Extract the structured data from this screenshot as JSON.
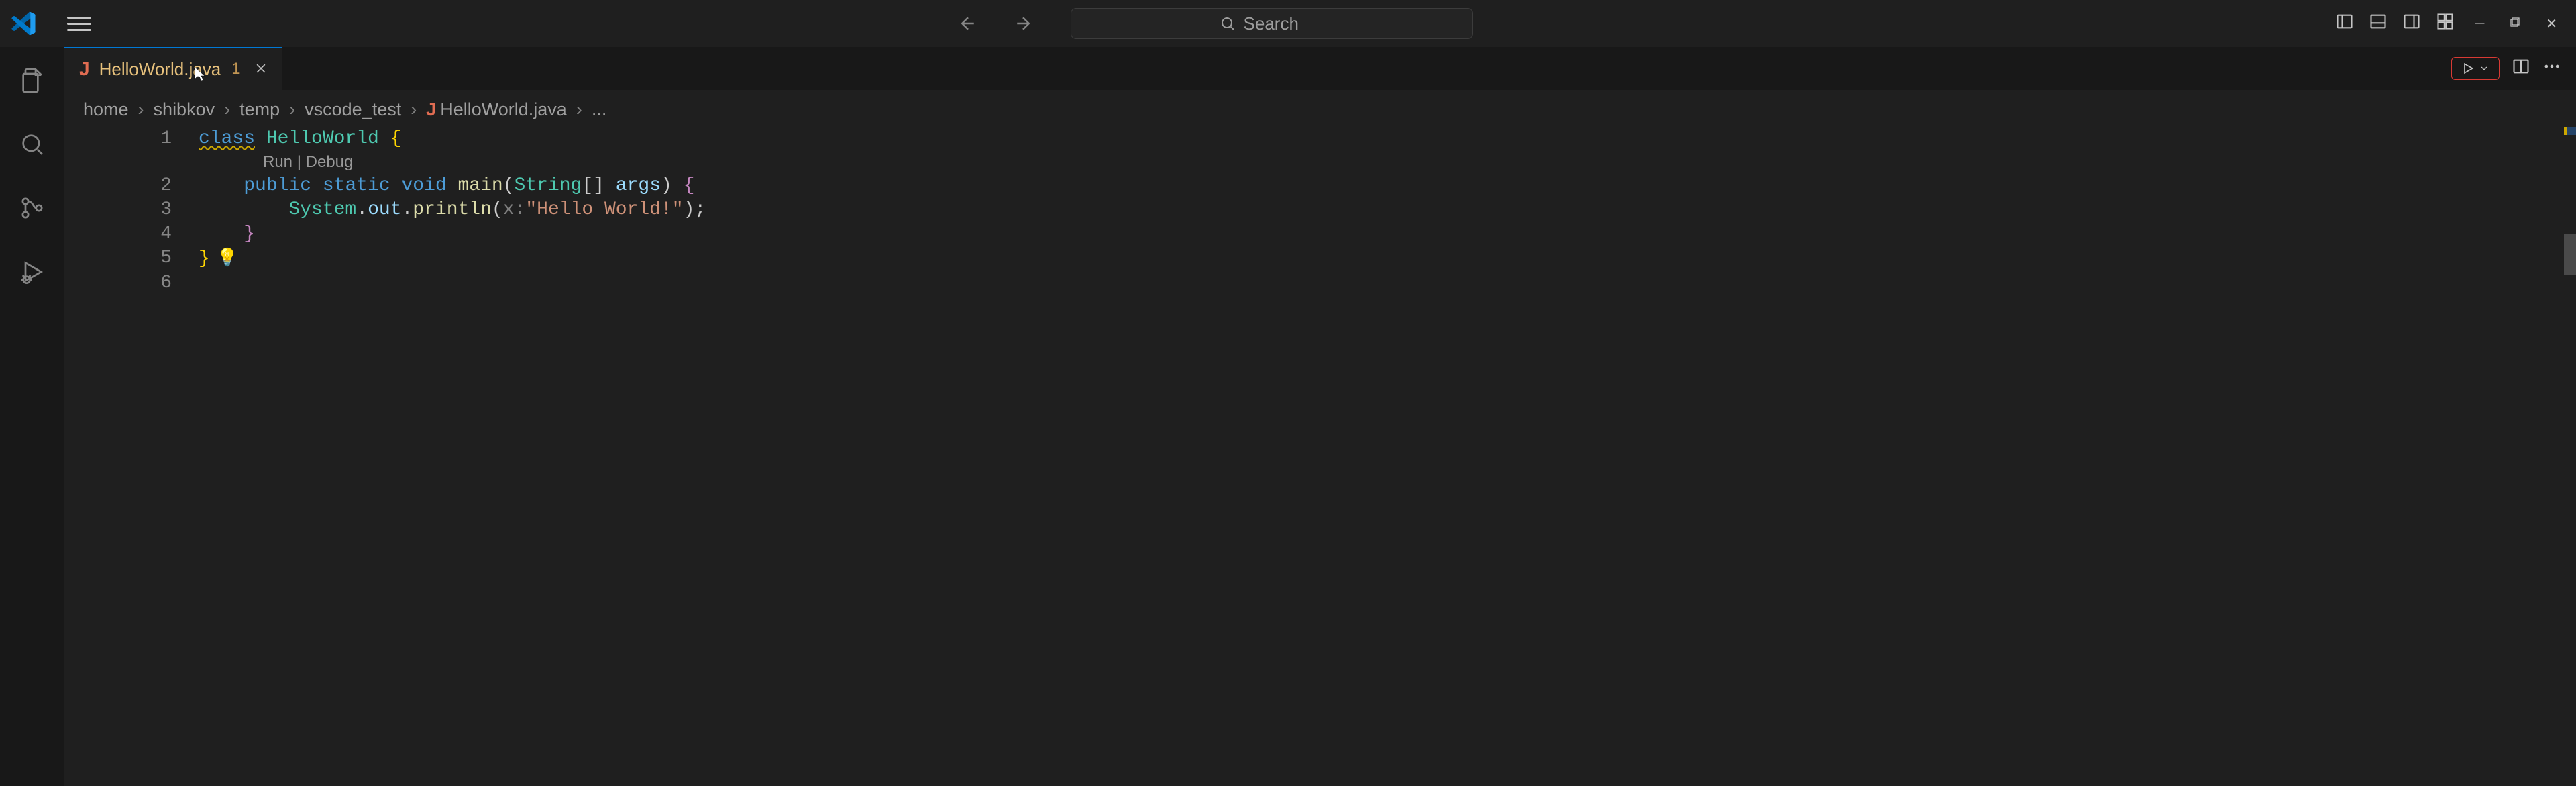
{
  "titlebar": {
    "search_placeholder": "Search"
  },
  "tab": {
    "filename": "HelloWorld.java",
    "dirty_indicator": "1"
  },
  "breadcrumb": {
    "parts": [
      "home",
      "shibkov",
      "temp",
      "vscode_test"
    ],
    "file": "HelloWorld.java",
    "symbol": "..."
  },
  "codelens": {
    "run": "Run",
    "debug": "Debug"
  },
  "code": {
    "line1": {
      "kw": "class",
      "cls": "HelloWorld",
      "open": "{"
    },
    "line2": {
      "mods": "public static",
      "ret": "void",
      "fn": "main",
      "lp": "(",
      "type": "String",
      "arr": "[]",
      "arg": "args",
      "rp": ")",
      "open": "{"
    },
    "line3": {
      "obj": "System",
      "dot1": ".",
      "field": "out",
      "dot2": ".",
      "call": "println",
      "lp": "(",
      "hint": "x:",
      "str": "\"Hello World!\"",
      "rp": ")",
      "semi": ";"
    },
    "line4": {
      "close": "}"
    },
    "line5": {
      "close": "}"
    }
  },
  "line_numbers": [
    "1",
    "2",
    "3",
    "4",
    "5",
    "6"
  ]
}
